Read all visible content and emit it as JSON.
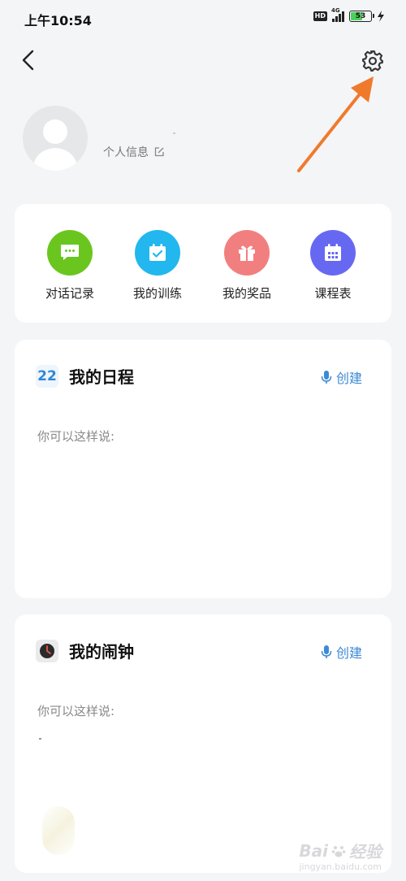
{
  "status_bar": {
    "time": "上午10:54",
    "hd": "HD",
    "network": "4G",
    "battery": "53",
    "icons": [
      "hd-badge-icon",
      "signal-icon",
      "battery-icon",
      "charging-bolt-icon"
    ]
  },
  "header": {
    "back_icon": "chevron-left-icon",
    "settings_icon": "gear-icon"
  },
  "profile": {
    "avatar_icon": "default-avatar-icon",
    "info_label": "个人信息",
    "edit_icon": "edit-icon"
  },
  "shortcuts": [
    {
      "label": "对话记录",
      "icon": "chat-bubble-icon",
      "color": "#6ac61e"
    },
    {
      "label": "我的训练",
      "icon": "calendar-check-icon",
      "color": "#22b7ee"
    },
    {
      "label": "我的奖品",
      "icon": "gift-icon",
      "color": "#f27f7f"
    },
    {
      "label": "课程表",
      "icon": "timetable-icon",
      "color": "#6768f2"
    }
  ],
  "schedule": {
    "icon_text": "22",
    "title": "我的日程",
    "create_label": "创建",
    "hint": "你可以这样说:"
  },
  "alarm": {
    "icon": "clock-icon",
    "title": "我的闹钟",
    "create_label": "创建",
    "hint": "你可以这样说:"
  },
  "watermark": {
    "brand": "Bai",
    "suffix": "经验",
    "url": "jingyan.baidu.com"
  },
  "colors": {
    "accent_blue": "#3d8ad6",
    "arrow_orange": "#f07a2c",
    "page_bg": "#f4f5f7"
  }
}
